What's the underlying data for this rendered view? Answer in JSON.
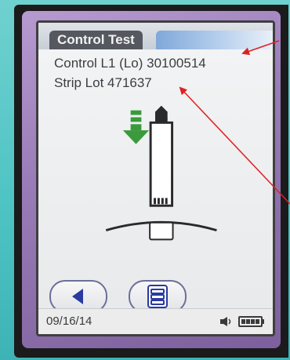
{
  "header": {
    "title": "Control Test"
  },
  "info": {
    "control_label": "Control L1 (Lo) 30100514",
    "strip_lot_label": "Strip Lot 471637"
  },
  "footer": {
    "date": "09/16/14"
  },
  "icons": {
    "back": "back-arrow-icon",
    "menu": "list-menu-icon",
    "insert": "insert-strip-arrow-icon",
    "sound": "sound-icon",
    "battery": "battery-icon"
  },
  "colors": {
    "accent_blue": "#2a3aa0",
    "arrow_green": "#3a9a3c",
    "annotation_red": "#e02020"
  }
}
